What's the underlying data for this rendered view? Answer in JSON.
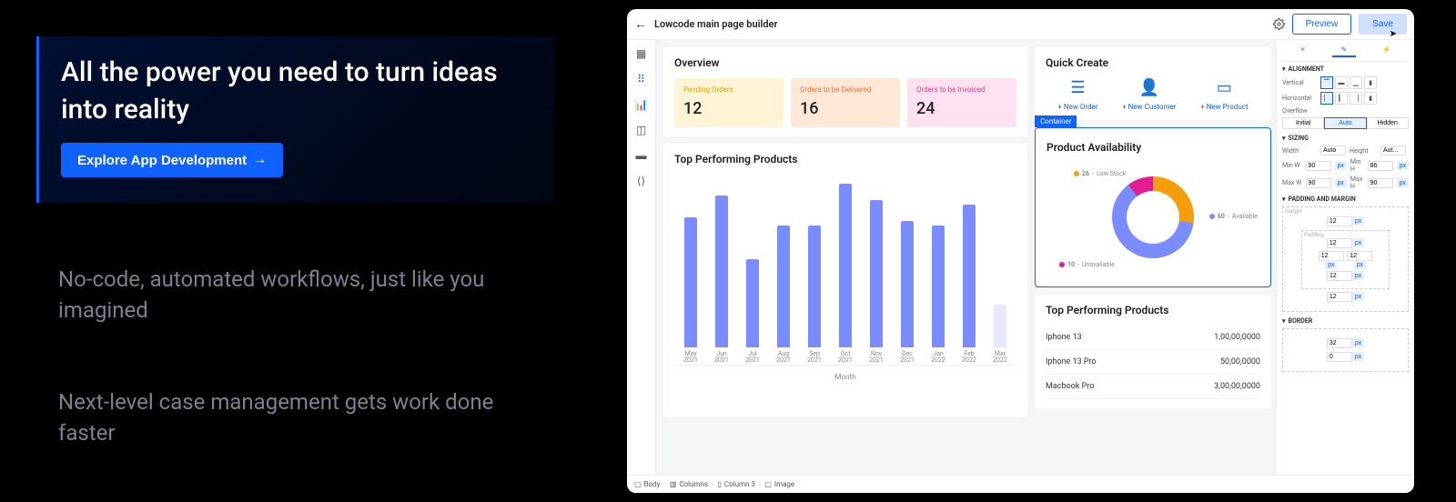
{
  "hero": {
    "title": "All the power you need to turn ideas into reality",
    "cta": "Explore App Development"
  },
  "blurbs": [
    "No-code, automated workflows, just like you imagined",
    "Next-level case management gets work done faster"
  ],
  "app": {
    "title": "Lowcode main page builder",
    "preview": "Preview",
    "save": "Save"
  },
  "overview": {
    "title": "Overview",
    "stats": [
      {
        "label": "Pending Orders",
        "value": "12"
      },
      {
        "label": "Orders to be Delivered",
        "value": "16"
      },
      {
        "label": "Orders to be Invoiced",
        "value": "24"
      }
    ]
  },
  "chart": {
    "title": "Top Performing Products",
    "xlabel": "Month"
  },
  "chart_data": {
    "type": "bar",
    "title": "Top Performing Products",
    "xlabel": "Month",
    "ylabel": "",
    "categories": [
      "May 2021",
      "Jun 2021",
      "Jul 2021",
      "Aug 2021",
      "Sep 2021",
      "Oct 2021",
      "Nov 2021",
      "Dec 2021",
      "Jan 2022",
      "Feb 2022",
      "Mar 2022"
    ],
    "values": [
      62,
      72,
      42,
      58,
      58,
      78,
      70,
      60,
      58,
      68,
      20
    ],
    "note": "Mar 2022 bar rendered faded/partial"
  },
  "quick_create": {
    "title": "Quick Create",
    "items": [
      {
        "label": "+ New Order"
      },
      {
        "label": "+ New Customer"
      },
      {
        "label": "+ New Product"
      }
    ]
  },
  "availability": {
    "tag": "Container",
    "title": "Product Availability",
    "segments": [
      {
        "value": "26",
        "label": "Low Stock",
        "color": "#f59e0b"
      },
      {
        "value": "60",
        "label": "Available",
        "color": "#7a8cff"
      },
      {
        "value": "10",
        "label": "Unavailable",
        "color": "#e11d8f"
      }
    ]
  },
  "top_products": {
    "title": "Top Performing Products",
    "rows": [
      {
        "name": "Iphone 13",
        "value": "1,00,00,0000"
      },
      {
        "name": "Iphone 13 Pro",
        "value": "50,00,0000"
      },
      {
        "name": "Macbook Pro",
        "value": "3,00,00,0000"
      }
    ]
  },
  "inspector": {
    "sections": {
      "alignment": "ALIGNMENT",
      "sizing": "SIZING",
      "padding": "PADDING AND MARGIN",
      "border": "BORDER"
    },
    "labels": {
      "vertical": "Vertical",
      "horizontal": "Horizontal",
      "overflow": "Overflow",
      "width": "Width",
      "height": "Height",
      "minw": "Min W",
      "minh": "Min H",
      "maxw": "Max W",
      "maxh": "Max H",
      "margin": "margin",
      "padding_lbl": "Padding"
    },
    "overflow_opts": [
      "Initial",
      "Auto",
      "Hidden"
    ],
    "overflow_active": "Auto",
    "width_val": "Auto",
    "height_val": "Aut...",
    "minw_val": "90",
    "minh_val": "86",
    "maxw_val": "90",
    "maxh_val": "90",
    "unit": "px",
    "margin_vals": {
      "top": "12",
      "right": "12",
      "bottom": "12",
      "left": "12"
    },
    "padding_vals": {
      "top": "12",
      "right": "12",
      "bottom": "12",
      "left": "12"
    },
    "border_vals": {
      "width": "32",
      "side": "0"
    }
  },
  "breadcrumb": [
    "Body",
    "Columns",
    "Column 3",
    "Image"
  ]
}
